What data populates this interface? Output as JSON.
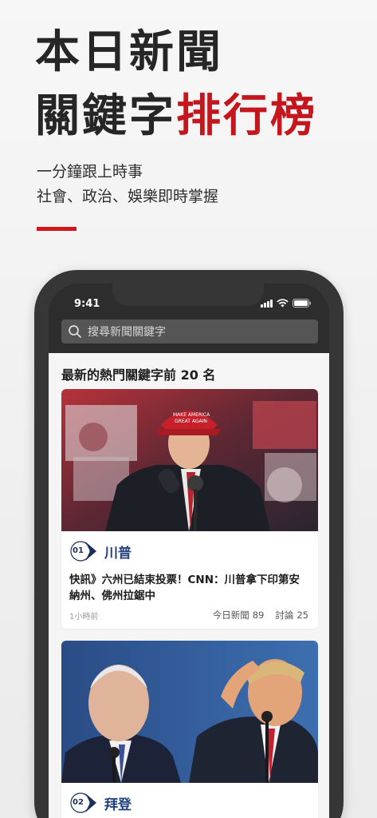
{
  "hero": {
    "line1": "本日新聞",
    "line2_prefix": "關鍵字",
    "line2_accent": "排行榜",
    "subtitle1": "一分鐘跟上時事",
    "subtitle2": "社會、政治、娛樂即時掌握",
    "accent_color": "#c4161c"
  },
  "status_bar": {
    "time": "9:41"
  },
  "search": {
    "placeholder": "搜尋新聞關鍵字"
  },
  "section": {
    "title": "最新的熱門關鍵字前 20 名"
  },
  "cards": [
    {
      "rank": "01",
      "keyword": "川普",
      "headline": "快訊》六州已結束投票！CNN：川普拿下印第安納州、佛州拉鋸中",
      "time_ago": "1小時前",
      "news_label": "今日新聞",
      "news_count": "89",
      "discuss_label": "討論",
      "discuss_count": "25",
      "photo_hat_text": "MAKE AMERICA GREAT AGAIN"
    },
    {
      "rank": "02",
      "keyword": "拜登"
    }
  ],
  "icons": [
    "search-icon",
    "signal-icon",
    "wifi-icon",
    "battery-icon",
    "rank-badge-icon"
  ]
}
